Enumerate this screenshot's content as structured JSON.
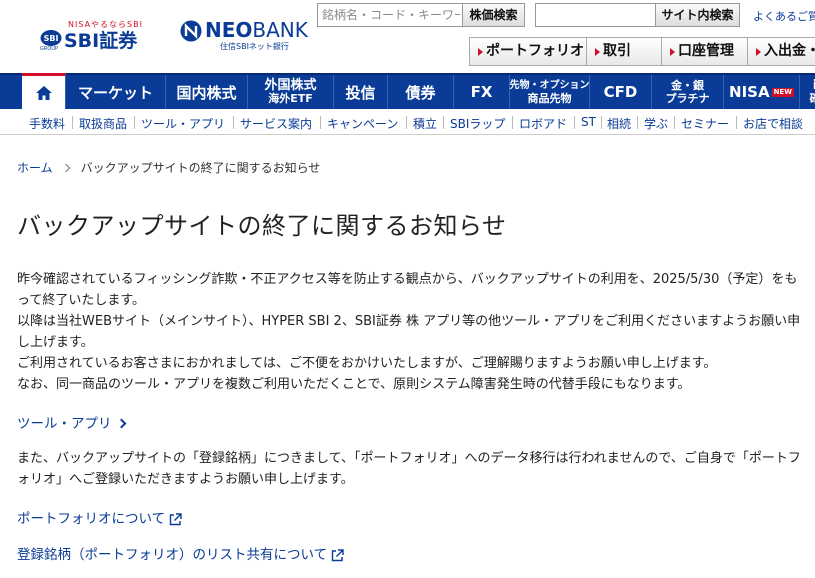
{
  "header": {
    "sbi_tagline": "NISAやるならSBI",
    "sbi_name": "SBI証券",
    "sbi_group": "GROUP",
    "neobank_name_bold": "NEO",
    "neobank_name_light": "BANK",
    "neobank_sub": "住信SBIネット銀行",
    "stock_search_placeholder": "銘柄名・コード・キーワード",
    "stock_search_button": "株価検索",
    "site_search_value": "",
    "site_search_button": "サイト内検索",
    "faq_link": "よくあるご質",
    "quick_buttons": [
      "ポートフォリオ",
      "取引",
      "口座管理",
      "入出金・"
    ]
  },
  "gnav": {
    "items": [
      {
        "label": "マーケット"
      },
      {
        "label": "国内株式"
      },
      {
        "line1": "外国株式",
        "line2": "海外ETF"
      },
      {
        "label": "投信"
      },
      {
        "label": "債券"
      },
      {
        "label": "FX"
      },
      {
        "line1": "先物・オプション",
        "line2": "商品先物"
      },
      {
        "label": "CFD"
      },
      {
        "line1": "金・銀",
        "line2": "プラチナ"
      },
      {
        "label": "NISA",
        "badge": "NEW"
      },
      {
        "line1": "i",
        "line2": "確"
      }
    ]
  },
  "subnav": {
    "items": [
      "手数料",
      "取扱商品",
      "ツール・アプリ",
      "サービス案内",
      "キャンペーン",
      "積立",
      "SBIラップ",
      "ロボアド",
      "ST",
      "相続",
      "学ぶ",
      "セミナー",
      "お店で相談"
    ]
  },
  "breadcrumb": {
    "home": "ホーム",
    "current": "バックアップサイトの終了に関するお知らせ"
  },
  "main": {
    "title": "バックアップサイトの終了に関するお知らせ",
    "para1": [
      "昨今確認されているフィッシング詐欺・不正アクセス等を防止する観点から、バックアップサイトの利用を、2025/5/30（予定）をもって終了いたします。",
      "以降は当社WEBサイト（メインサイト）、HYPER SBI 2、SBI証券 株 アプリ等の他ツール・アプリをご利用くださいますようお願い申し上げます。",
      "ご利用されているお客さまにおかれましては、ご不便をおかけいたしますが、ご理解賜りますようお願い申し上げます。",
      "なお、同一商品のツール・アプリを複数ご利用いただくことで、原則システム障害発生時の代替手段にもなります。"
    ],
    "link_tools": "ツール・アプリ",
    "para2": "また、バックアップサイトの「登録銘柄」につきまして、「ポートフォリオ」へのデータ移行は行われませんので、ご自身で「ポートフォリオ」へご登録いただきますようお願い申し上げます。",
    "link_portfolio": "ポートフォリオについて",
    "link_share": "登録銘柄（ポートフォリオ）のリスト共有について"
  },
  "colors": {
    "brand_blue": "#0a3b96",
    "accent_red": "#d0102a"
  }
}
